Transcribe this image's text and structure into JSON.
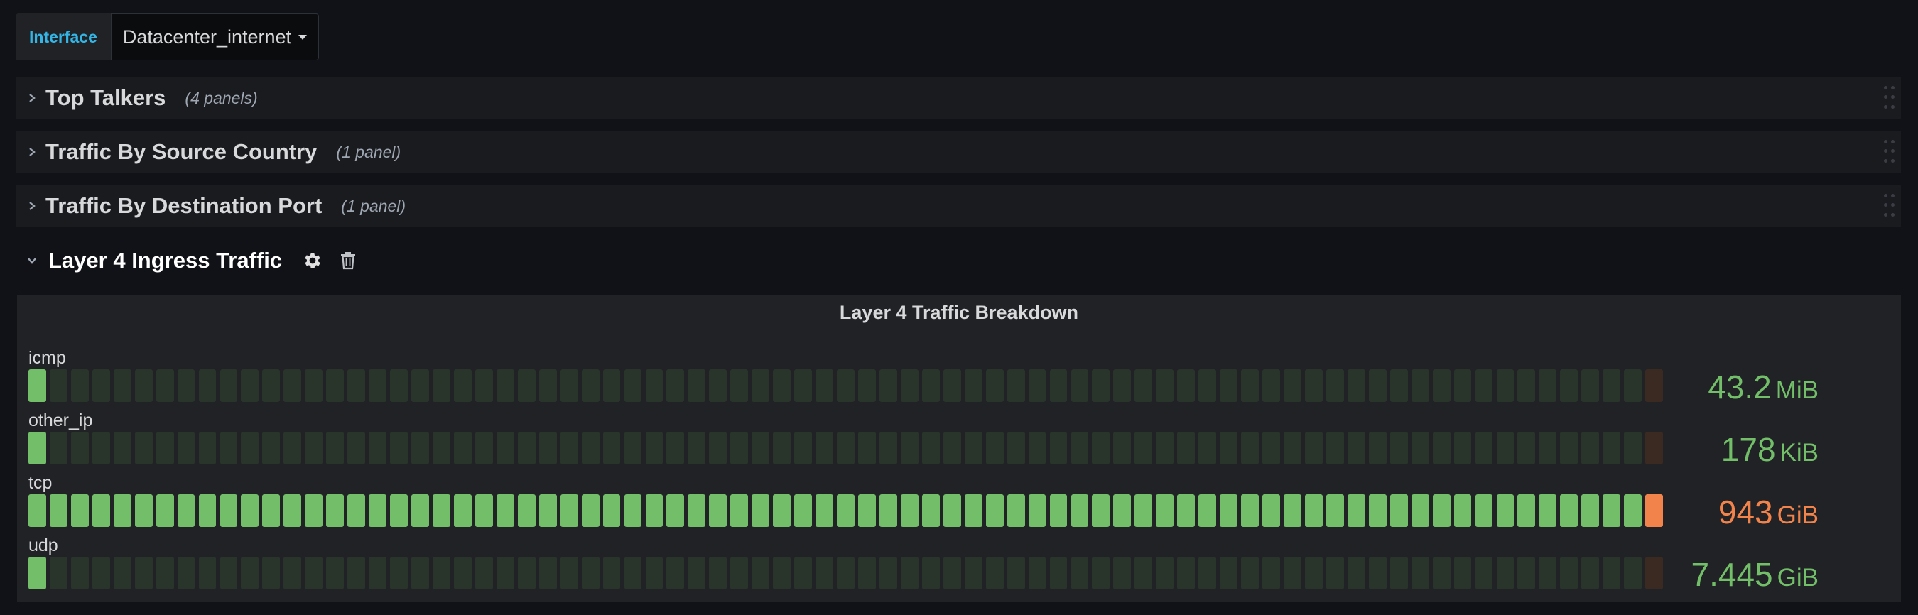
{
  "colors": {
    "background": "#111217",
    "panel": "#202226",
    "row": "#1a1b1f",
    "variable_label": "#33b5e5",
    "green_on": "#73bf69",
    "green_off": "#29352a",
    "orange_on": "#f2834b",
    "orange_off": "#3b2a22"
  },
  "variable": {
    "label": "Interface",
    "value": "Datacenter_internet"
  },
  "rows": [
    {
      "title": "Top Talkers",
      "count": "(4 panels)",
      "collapsed": true
    },
    {
      "title": "Traffic By Source Country",
      "count": "(1 panel)",
      "collapsed": true
    },
    {
      "title": "Traffic By Destination Port",
      "count": "(1 panel)",
      "collapsed": true
    }
  ],
  "open_row": {
    "title": "Layer 4 Ingress Traffic",
    "icons": [
      "gear-icon",
      "trash-icon"
    ]
  },
  "panel": {
    "title": "Layer 4 Traffic Breakdown",
    "segments": 77,
    "gauges": [
      {
        "name": "icmp",
        "value": "43.2",
        "unit": "MiB",
        "fill_fraction": 0.013,
        "status": "green"
      },
      {
        "name": "other_ip",
        "value": "178",
        "unit": "KiB",
        "fill_fraction": 0.013,
        "status": "green"
      },
      {
        "name": "tcp",
        "value": "943",
        "unit": "GiB",
        "fill_fraction": 1.0,
        "status": "orange"
      },
      {
        "name": "udp",
        "value": "7.445",
        "unit": "GiB",
        "fill_fraction": 0.013,
        "status": "green"
      }
    ]
  }
}
